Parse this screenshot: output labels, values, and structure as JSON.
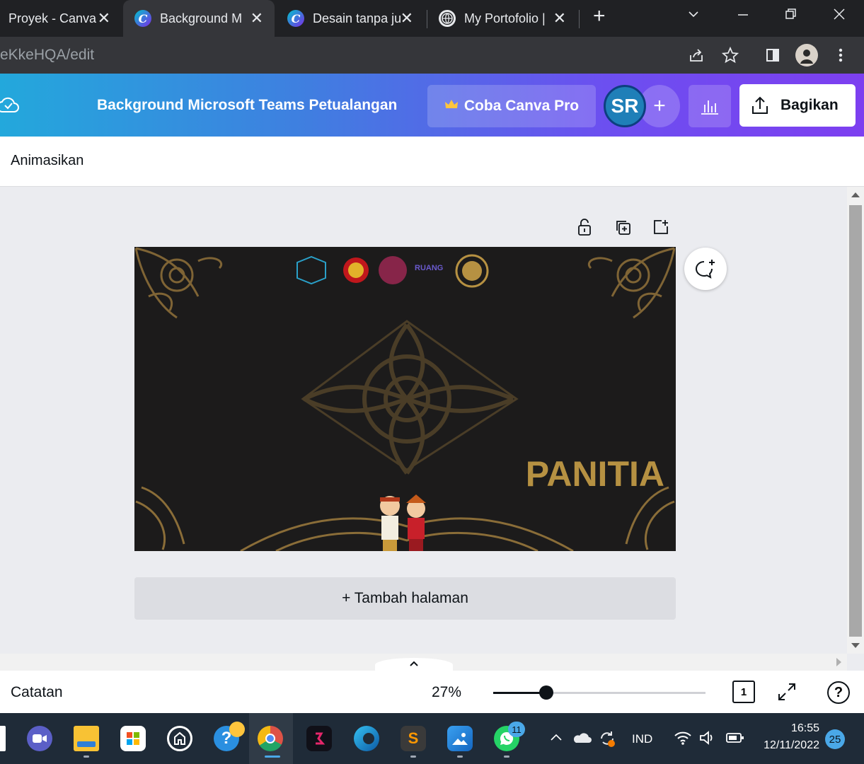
{
  "browser": {
    "tabs": [
      {
        "title": "Proyek - Canva",
        "active": false,
        "favicon": "none"
      },
      {
        "title": "Background M",
        "active": true,
        "favicon": "canva-icon"
      },
      {
        "title": "Desain tanpa ju",
        "active": false,
        "favicon": "canva-icon"
      },
      {
        "title": "My Portofolio |",
        "active": false,
        "favicon": "globe-icon"
      }
    ],
    "new_tab_label": "+",
    "url": "eKkeHQA/edit"
  },
  "canva": {
    "doc_title": "Background Microsoft Teams Petualangan",
    "pro_button": "Coba Canva Pro",
    "avatar_initials": "SR",
    "add_person": "+",
    "share_button": "Bagikan",
    "toolbar_animate": "Animasikan",
    "design_text": "PANITIA",
    "add_page": "+ Tambah halaman",
    "notes": "Catatan",
    "zoom": "27%",
    "zoom_value": 27,
    "page_number": "1",
    "help": "?",
    "accent_gold": "#b69142",
    "gradient_start": "#23a8dc",
    "gradient_end": "#7d3ff0"
  },
  "taskbar": {
    "whatsapp_badge": "11",
    "language": "IND",
    "time": "16:55",
    "date": "12/11/2022",
    "notifications": "25"
  }
}
